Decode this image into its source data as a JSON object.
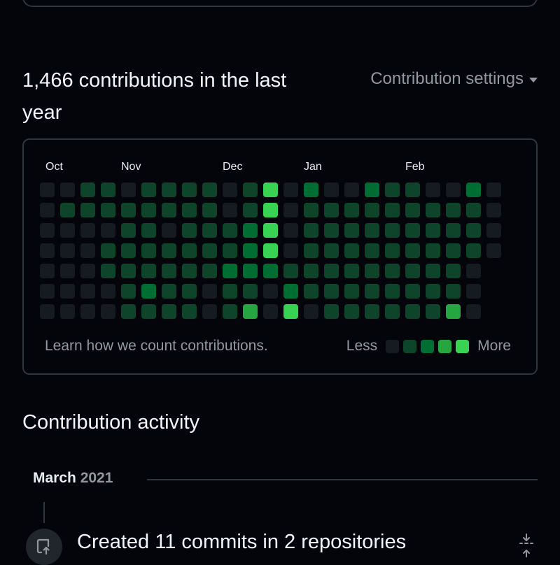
{
  "header": {
    "contributions_title": "1,466 contributions in the last year",
    "settings_label": "Contribution settings"
  },
  "graph": {
    "months": [
      "Oct",
      "Nov",
      "Dec",
      "Jan",
      "Feb"
    ],
    "levels": [
      [
        0,
        0,
        0,
        0,
        0,
        0,
        0
      ],
      [
        0,
        1,
        0,
        0,
        0,
        0,
        0
      ],
      [
        1,
        1,
        0,
        0,
        0,
        0,
        0
      ],
      [
        1,
        1,
        0,
        1,
        1,
        0,
        0
      ],
      [
        0,
        1,
        1,
        1,
        1,
        1,
        1
      ],
      [
        1,
        1,
        1,
        1,
        1,
        2,
        1
      ],
      [
        1,
        1,
        0,
        1,
        1,
        1,
        1
      ],
      [
        1,
        1,
        1,
        1,
        1,
        1,
        1
      ],
      [
        1,
        1,
        1,
        1,
        1,
        0,
        0
      ],
      [
        0,
        0,
        1,
        1,
        2,
        1,
        1
      ],
      [
        1,
        1,
        2,
        2,
        2,
        1,
        3
      ],
      [
        4,
        4,
        4,
        4,
        2,
        0,
        0
      ],
      [
        0,
        0,
        0,
        0,
        1,
        2,
        4
      ],
      [
        2,
        1,
        1,
        1,
        1,
        1,
        0
      ],
      [
        0,
        1,
        1,
        1,
        1,
        1,
        1
      ],
      [
        0,
        1,
        1,
        1,
        1,
        1,
        1
      ],
      [
        2,
        1,
        1,
        1,
        1,
        1,
        1
      ],
      [
        1,
        1,
        1,
        1,
        1,
        1,
        1
      ],
      [
        1,
        1,
        1,
        1,
        1,
        1,
        1
      ],
      [
        0,
        1,
        1,
        1,
        1,
        1,
        1
      ],
      [
        0,
        1,
        1,
        1,
        1,
        1,
        3
      ],
      [
        2,
        1,
        1,
        1,
        0,
        0,
        0
      ],
      [
        0,
        0,
        0,
        0,
        null,
        null,
        null
      ]
    ],
    "learn_link": "Learn how we count contributions.",
    "legend_less": "Less",
    "legend_more": "More",
    "level_colors": [
      "#161b22",
      "#0e4429",
      "#006d32",
      "#26a641",
      "#39d353"
    ]
  },
  "activity": {
    "title": "Contribution activity",
    "period_month": "March",
    "period_year": "2021",
    "event_text": "Created 11 commits in 2 repositories"
  },
  "icons": {
    "event": "repo-push-icon",
    "collapse": "fold-icon",
    "settings_caret": "triangle-down-icon"
  }
}
